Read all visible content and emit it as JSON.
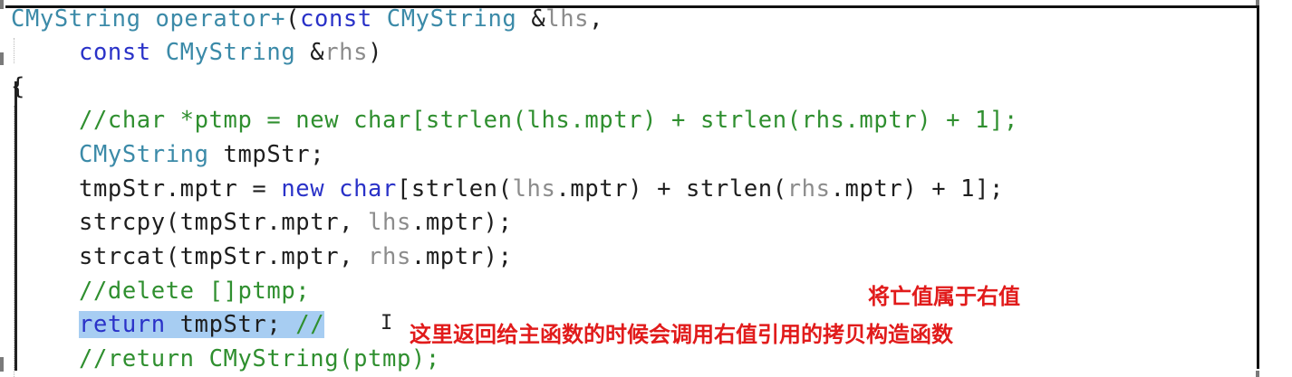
{
  "code": {
    "l1": {
      "type": "CMyString",
      "op": "operator+",
      "paren": "(",
      "kw": "const",
      "type2": "CMyString",
      "amp": "&",
      "param": "lhs",
      "comma": ","
    },
    "l2": {
      "kw": "const",
      "type": "CMyString",
      "amp": "&",
      "param": "rhs",
      "close": ")"
    },
    "l3": {
      "brace": "{"
    },
    "l4": {
      "comment": "//char *ptmp = new char[strlen(lhs.mptr) + strlen(rhs.mptr) + 1];"
    },
    "l5": {
      "type": "CMyString",
      "rest": " tmpStr;"
    },
    "l6": {
      "pre": "tmpStr.mptr = ",
      "kw": "new",
      "sp": " ",
      "kw2": "char",
      "mid1": "[strlen(",
      "p1": "lhs",
      "mid2": ".mptr) + strlen(",
      "p2": "rhs",
      "end": ".mptr) + 1];"
    },
    "l7": {
      "pre": "strcpy(tmpStr.mptr, ",
      "p": "lhs",
      "end": ".mptr);"
    },
    "l8": {
      "pre": "strcat(tmpStr.mptr, ",
      "p": "rhs",
      "end": ".mptr);"
    },
    "l9": {
      "comment": "//delete []ptmp;"
    },
    "l10": {
      "kw": "return",
      "rest": " tmpStr; ",
      "comment": "//"
    },
    "l11": {
      "comment": "//return CMyString(ptmp);"
    }
  },
  "annotations": {
    "a1": "将亡值属于右值",
    "a2": "这里返回给主函数的时候会调用右值引用的拷贝构造函数"
  },
  "cursor_glyph": "I"
}
